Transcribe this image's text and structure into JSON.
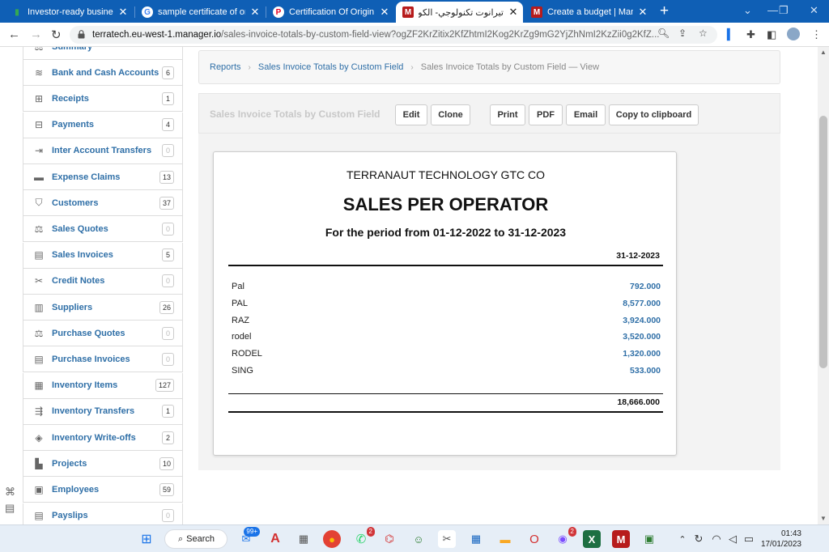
{
  "browser": {
    "tabs": [
      {
        "title": "Investor-ready business p",
        "icon": "chart-bar-icon",
        "color": "#34a853"
      },
      {
        "title": "sample certificate of orig",
        "icon": "google-icon",
        "color": "#ffffff"
      },
      {
        "title": "Certification Of Origin Te",
        "icon": "pinterest-icon",
        "color": "#e60023"
      },
      {
        "title": "تيرانوت تكنولوجي- الكويت",
        "icon": "manager-icon",
        "color": "#b71c1c",
        "active": true
      },
      {
        "title": "Create a budget | Manag",
        "icon": "manager-icon",
        "color": "#b71c1c"
      }
    ],
    "new_tab": "+",
    "url_host": "terratech.eu-west-1.manager.io",
    "url_path": "/sales-invoice-totals-by-custom-field-view?ogZF2KrZitix2KfZhtmI2Kog2KrZg9mG2YjZhNmI2KzZii0g2KfZ..."
  },
  "sidebar": {
    "items": [
      {
        "label": "Summary",
        "count": "",
        "icon": "summary-icon"
      },
      {
        "label": "Bank and Cash Accounts",
        "count": "6",
        "icon": "coins-icon"
      },
      {
        "label": "Receipts",
        "count": "1",
        "icon": "plus-square-icon"
      },
      {
        "label": "Payments",
        "count": "4",
        "icon": "minus-square-icon"
      },
      {
        "label": "Inter Account Transfers",
        "count": "0",
        "icon": "transfer-icon"
      },
      {
        "label": "Expense Claims",
        "count": "13",
        "icon": "card-icon"
      },
      {
        "label": "Customers",
        "count": "37",
        "icon": "customers-icon"
      },
      {
        "label": "Sales Quotes",
        "count": "0",
        "icon": "scale-icon"
      },
      {
        "label": "Sales Invoices",
        "count": "5",
        "icon": "document-icon"
      },
      {
        "label": "Credit Notes",
        "count": "0",
        "icon": "scissors-icon"
      },
      {
        "label": "Suppliers",
        "count": "26",
        "icon": "factory-icon"
      },
      {
        "label": "Purchase Quotes",
        "count": "0",
        "icon": "scale-icon"
      },
      {
        "label": "Purchase Invoices",
        "count": "0",
        "icon": "document-icon"
      },
      {
        "label": "Inventory Items",
        "count": "127",
        "icon": "boxes-icon"
      },
      {
        "label": "Inventory Transfers",
        "count": "1",
        "icon": "dolly-icon"
      },
      {
        "label": "Inventory Write-offs",
        "count": "2",
        "icon": "eraser-icon"
      },
      {
        "label": "Projects",
        "count": "10",
        "icon": "projects-icon"
      },
      {
        "label": "Employees",
        "count": "59",
        "icon": "id-card-icon"
      },
      {
        "label": "Payslips",
        "count": "0",
        "icon": "payslip-icon"
      }
    ]
  },
  "breadcrumb": {
    "items": [
      "Reports",
      "Sales Invoice Totals by Custom Field"
    ],
    "current": "Sales Invoice Totals by Custom Field — View"
  },
  "actions": {
    "title": "Sales Invoice Totals by Custom Field",
    "edit": "Edit",
    "clone": "Clone",
    "print": "Print",
    "pdf": "PDF",
    "email": "Email",
    "copy": "Copy to clipboard"
  },
  "report": {
    "company": "TERRANAUT TECHNOLOGY GTC CO",
    "title": "SALES PER OPERATOR",
    "period": "For the period from 01-12-2022 to 31-12-2023",
    "column": "31-12-2023",
    "rows": [
      {
        "name": "Pal",
        "value": "792.000"
      },
      {
        "name": "PAL",
        "value": "8,577.000"
      },
      {
        "name": "RAZ",
        "value": "3,924.000"
      },
      {
        "name": "rodel",
        "value": "3,520.000"
      },
      {
        "name": "RODEL",
        "value": "1,320.000"
      },
      {
        "name": "SING",
        "value": "533.000"
      }
    ],
    "total": "18,666.000"
  },
  "taskbar": {
    "search": "Search",
    "mail_badge": "99+",
    "whatsapp_badge": "2",
    "messenger_badge": "2",
    "time": "01:43",
    "date": "17/01/2023"
  }
}
